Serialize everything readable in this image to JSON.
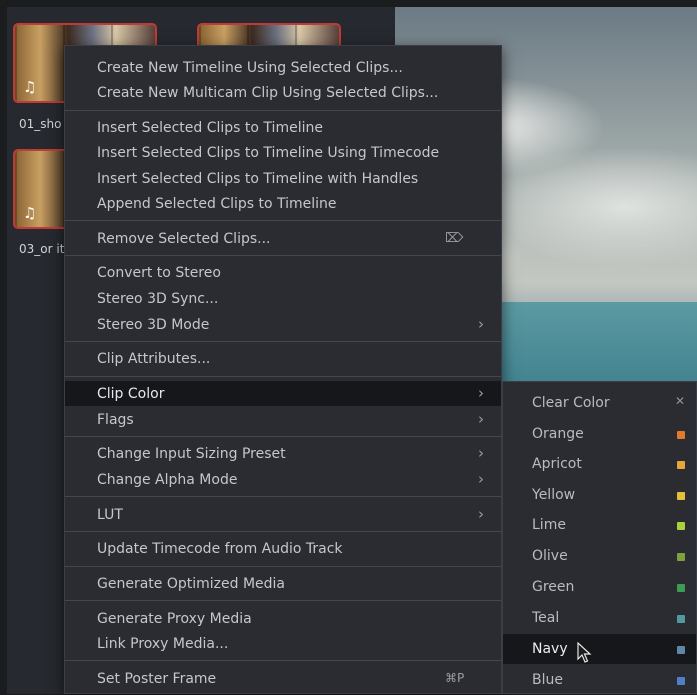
{
  "media_pool": {
    "clips": [
      {
        "name": "01_sho"
      },
      {
        "name": ""
      },
      {
        "name": "03_or it"
      }
    ]
  },
  "menu": {
    "groups": [
      [
        "Create New Timeline Using Selected Clips...",
        "Create New Multicam Clip Using Selected Clips..."
      ],
      [
        "Insert Selected Clips to Timeline",
        "Insert Selected Clips to Timeline Using Timecode",
        "Insert Selected Clips to Timeline with Handles",
        "Append Selected Clips to Timeline"
      ],
      [
        "Remove Selected Clips..."
      ],
      [
        "Convert to Stereo",
        "Stereo 3D Sync...",
        "Stereo 3D Mode"
      ],
      [
        "Clip Attributes..."
      ],
      [
        "Clip Color",
        "Flags"
      ],
      [
        "Change Input Sizing Preset",
        "Change Alpha Mode"
      ],
      [
        "LUT"
      ],
      [
        "Update Timecode from Audio Track"
      ],
      [
        "Generate Optimized Media"
      ],
      [
        "Generate Proxy Media",
        "Link Proxy Media..."
      ],
      [
        "Set Poster Frame"
      ]
    ],
    "items": {
      "create_timeline": "Create New Timeline Using Selected Clips...",
      "create_multicam": "Create New Multicam Clip Using Selected Clips...",
      "insert_clips": "Insert Selected Clips to Timeline",
      "insert_timecode": "Insert Selected Clips to Timeline Using Timecode",
      "insert_handles": "Insert Selected Clips to Timeline with Handles",
      "append_clips": "Append Selected Clips to Timeline",
      "remove_clips": "Remove Selected Clips...",
      "convert_stereo": "Convert to Stereo",
      "stereo_sync": "Stereo 3D Sync...",
      "stereo_mode": "Stereo 3D Mode",
      "clip_attributes": "Clip Attributes...",
      "clip_color": "Clip Color",
      "flags": "Flags",
      "input_sizing": "Change Input Sizing Preset",
      "alpha_mode": "Change Alpha Mode",
      "lut": "LUT",
      "update_timecode": "Update Timecode from Audio Track",
      "optimized_media": "Generate Optimized Media",
      "proxy_media": "Generate Proxy Media",
      "link_proxy": "Link Proxy Media...",
      "poster_frame": "Set Poster Frame"
    },
    "shortcuts": {
      "poster_frame": "⌘P"
    },
    "icons": {
      "remove": "delete-key-icon",
      "submenu": "chevron-right-icon"
    },
    "active_item": "Clip Color"
  },
  "clip_color_submenu": {
    "clear_label": "Clear Color",
    "clear_icon": "close-icon",
    "colors": [
      {
        "label": "Orange",
        "hex": "#e07b2e"
      },
      {
        "label": "Apricot",
        "hex": "#e8a63a"
      },
      {
        "label": "Yellow",
        "hex": "#e3c23a"
      },
      {
        "label": "Lime",
        "hex": "#a8d13c"
      },
      {
        "label": "Olive",
        "hex": "#7aa33b"
      },
      {
        "label": "Green",
        "hex": "#3f9a52"
      },
      {
        "label": "Teal",
        "hex": "#4e9aa0"
      },
      {
        "label": "Navy",
        "hex": "#5e86a6"
      },
      {
        "label": "Blue",
        "hex": "#4f7fc4"
      }
    ],
    "hovered": "Navy"
  },
  "theme": {
    "clip_border": "#c03a36",
    "menu_bg": "#2a2c31",
    "menu_active_bg": "#16171a"
  }
}
